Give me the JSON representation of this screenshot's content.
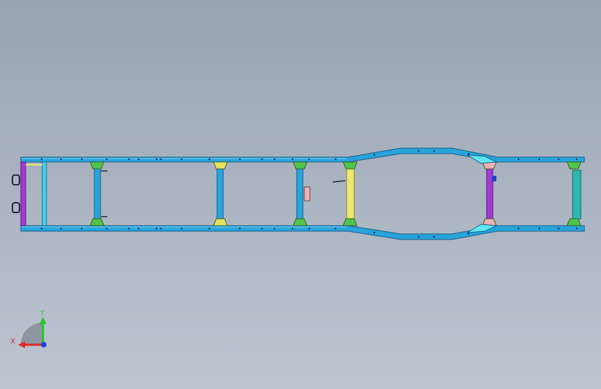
{
  "viewport": {
    "background_top": "#99a4b2",
    "background_bottom": "#bcc4d0"
  },
  "model": {
    "frame_color": "#28a4dc",
    "frame_edge_color": "#1a5a86",
    "crossmember_colors": {
      "rear_end": "#a23bd2",
      "rear_end_inner": "#44d4f0",
      "tube": "#28a4dc",
      "mid": "#e8e872",
      "rear_axle": "#a23bd2",
      "front_end": "#2ab8b0"
    },
    "gusset_colors": {
      "green": "#4ec44a",
      "yellow": "#e4e264",
      "pink": "#f0b0b8",
      "cyan": "#60e8f0"
    }
  },
  "triad": {
    "x_label": "X",
    "y_label": "Y",
    "x_color": "#e02828",
    "y_color": "#24c424",
    "z_color": "#2040e0"
  }
}
